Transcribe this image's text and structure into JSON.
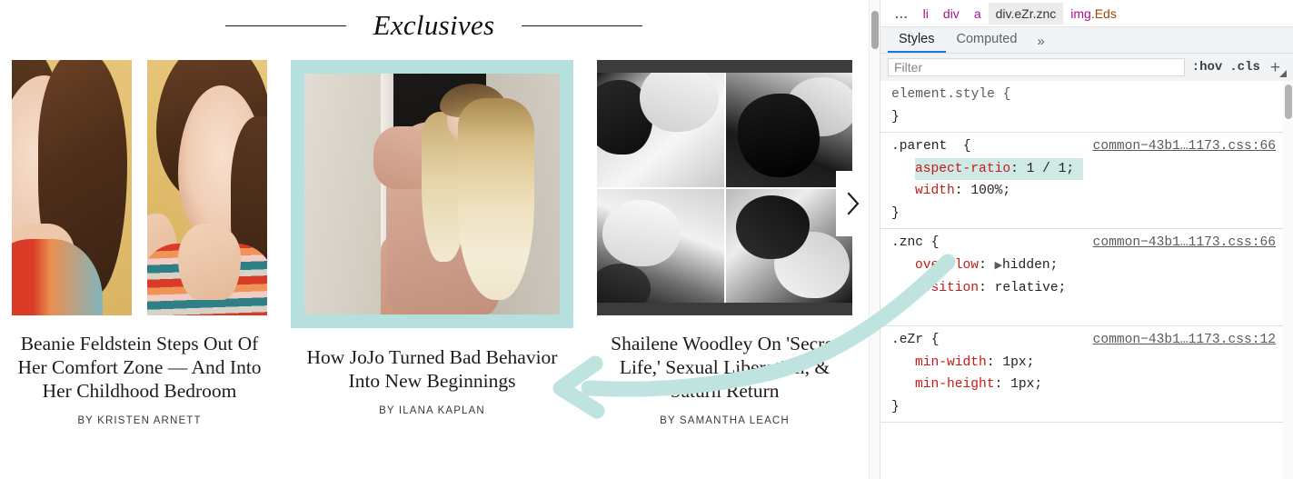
{
  "page": {
    "section_title": "Exclusives",
    "next_button_icon": "chevron-right-icon",
    "cards": [
      {
        "title": "Beanie Feldstein Steps Out Of Her Comfort Zone — And Into Her Childhood Bedroom",
        "byline": "BY KRISTEN ARNETT",
        "image_alt": "two-panel-color-portrait",
        "highlighted": false
      },
      {
        "title": "How JoJo Turned Bad Behavior Into New Beginnings",
        "byline": "BY ILANA KAPLAN",
        "image_alt": "blonde-woman-in-doorway",
        "highlighted": true
      },
      {
        "title": "Shailene Woodley On 'Secret Life,' Sexual Liberation, & Saturn Return",
        "byline": "BY SAMANTHA LEACH",
        "image_alt": "black-and-white-four-panel-grid",
        "highlighted": false
      }
    ]
  },
  "devtools": {
    "breadcrumb": [
      {
        "text": "...",
        "type": "dots",
        "selected": false
      },
      {
        "tag": "li",
        "cls": "",
        "selected": false
      },
      {
        "tag": "div",
        "cls": "",
        "selected": false
      },
      {
        "tag": "a",
        "cls": "",
        "selected": false
      },
      {
        "tag": "div",
        "cls": ".eZr.znc",
        "selected": true
      },
      {
        "tag": "img",
        "cls": ".Eds",
        "selected": false
      }
    ],
    "tabs": [
      {
        "label": "Styles",
        "active": true
      },
      {
        "label": "Computed",
        "active": false
      }
    ],
    "more_tabs_icon": "chevron-double-right-icon",
    "toolbar": {
      "filter_placeholder": "Filter",
      "filter_value": "",
      "hov_label": ":hov",
      "cls_label": ".cls",
      "new_rule_label": "+"
    },
    "rules": [
      {
        "selector": "element.style {",
        "source": "",
        "declarations": [],
        "closing": "}"
      },
      {
        "selector": ".parent  {",
        "source": "common−43b1…1173.css:66",
        "declarations": [
          {
            "property": "aspect-ratio",
            "value": "1 / 1;",
            "highlighted": true,
            "expandable": false
          },
          {
            "property": "width",
            "value": "100%;",
            "highlighted": false,
            "expandable": false
          }
        ],
        "closing": "}"
      },
      {
        "selector": ".znc {",
        "source": "common−43b1…1173.css:66",
        "declarations": [
          {
            "property": "overflow",
            "value": "hidden;",
            "highlighted": false,
            "expandable": true
          },
          {
            "property": "position",
            "value": "relative;",
            "highlighted": false,
            "expandable": false
          }
        ],
        "closing": "}"
      },
      {
        "selector": ".eZr {",
        "source": "common−43b1…1173.css:12",
        "declarations": [
          {
            "property": "min-width",
            "value": "1px;",
            "highlighted": false,
            "expandable": false
          },
          {
            "property": "min-height",
            "value": "1px;",
            "highlighted": false,
            "expandable": false
          }
        ],
        "closing": "}"
      }
    ]
  },
  "annotation": {
    "arrow_color": "#bfe3df",
    "arrow_name": "pointing-arrow-from-css-to-card"
  },
  "colors": {
    "highlight_mint": "#b6e0dd",
    "devtools_accent": "#1a73e8",
    "css_property_red": "#c41a16",
    "tag_purple": "#a61390",
    "class_brown": "#994500",
    "decl_highlight": "#cfe9e5"
  }
}
